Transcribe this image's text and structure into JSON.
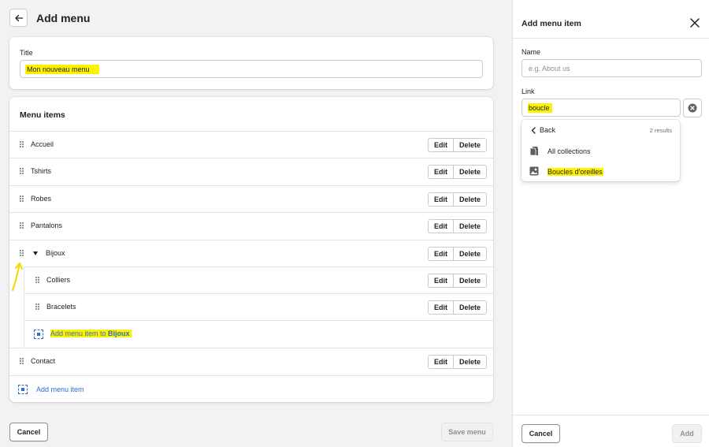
{
  "header": {
    "title": "Add menu"
  },
  "title_card": {
    "label": "Title",
    "value": "Mon nouveau menu"
  },
  "menu_card": {
    "heading": "Menu items",
    "edit_label": "Edit",
    "delete_label": "Delete",
    "items": [
      {
        "label": "Accueil"
      },
      {
        "label": "Tshirts"
      },
      {
        "label": "Robes"
      },
      {
        "label": "Pantalons"
      },
      {
        "label": "Bijoux",
        "expanded": true
      },
      {
        "label": "Colliers",
        "nested": true
      },
      {
        "label": "Bracelets",
        "nested": true
      },
      {
        "label": "Contact"
      }
    ],
    "add_nested_prefix": "Add menu item to ",
    "add_nested_target": "Bijoux",
    "add_item_label": "Add menu item"
  },
  "footer": {
    "cancel_label": "Cancel",
    "save_label": "Save menu"
  },
  "panel": {
    "title": "Add menu item",
    "name_label": "Name",
    "name_placeholder": "e.g. About us",
    "link_label": "Link",
    "link_value": "boucle",
    "dropdown": {
      "back_label": "Back",
      "results_count": "2 results",
      "options": [
        {
          "label": "All collections",
          "icon": "collections-icon"
        },
        {
          "label": "Boucles d'oreilles",
          "icon": "image-icon"
        }
      ]
    },
    "cancel_label": "Cancel",
    "add_label": "Add"
  },
  "colors": {
    "highlight": "#fff200",
    "link": "#2c6ecb",
    "annotation_arrow": "#f5d90a"
  }
}
